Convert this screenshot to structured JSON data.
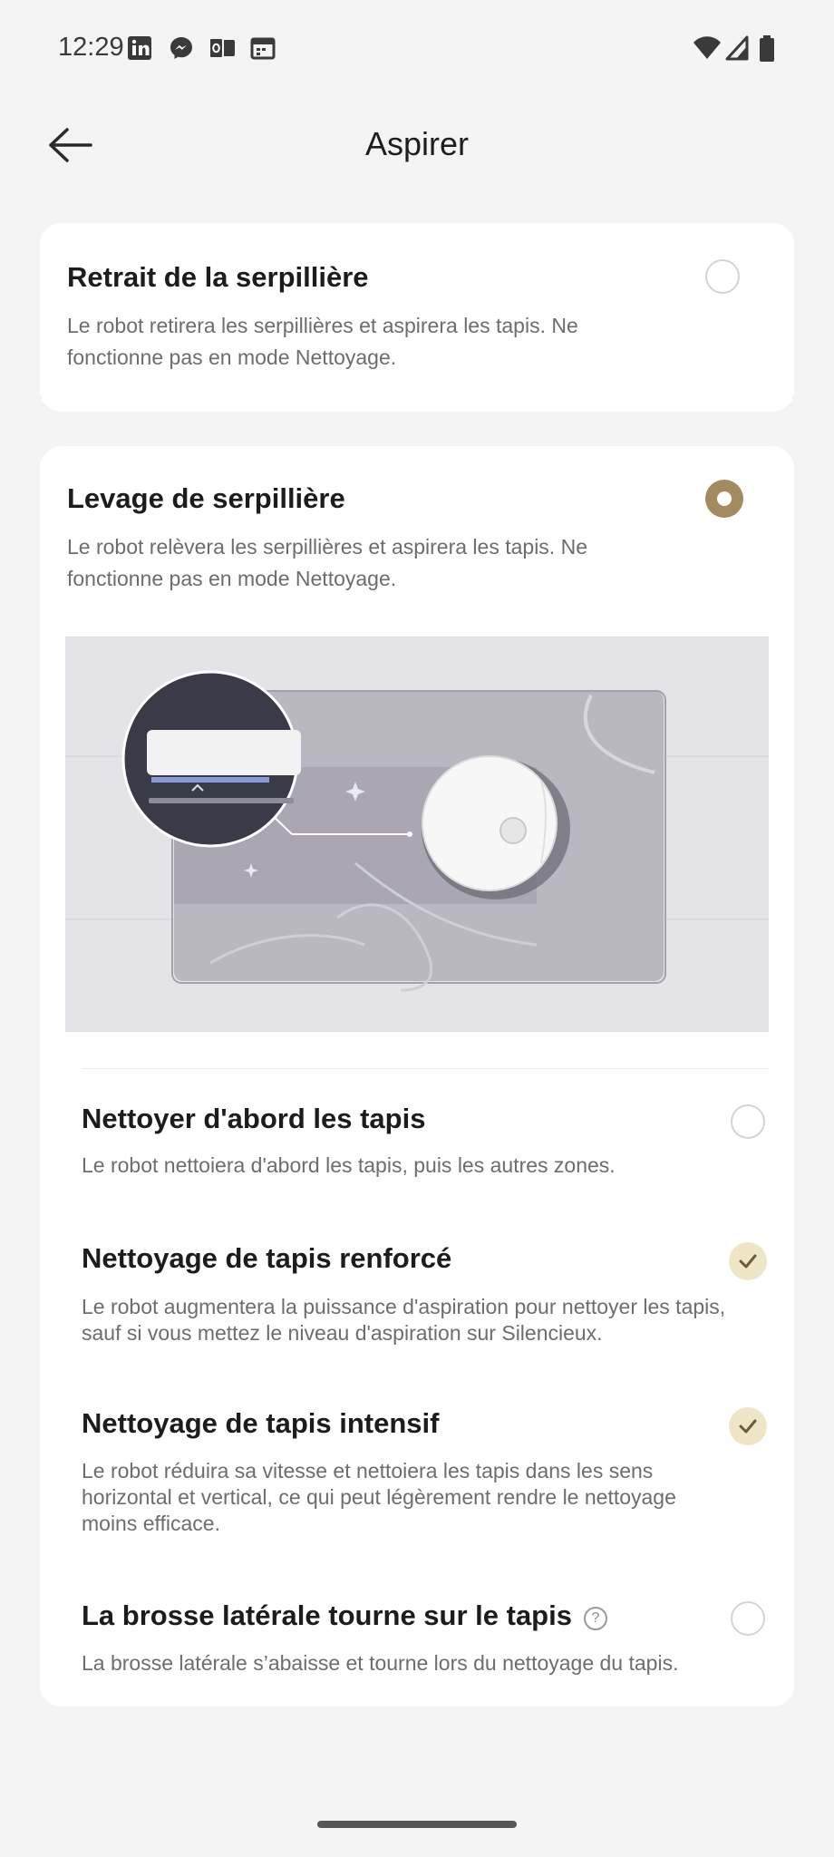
{
  "status_bar": {
    "time": "12:29",
    "notification_icons": [
      "linkedin-icon",
      "messenger-icon",
      "outlook-icon",
      "calendar-icon"
    ],
    "system_icons": [
      "wifi-icon",
      "signal-icon",
      "battery-icon"
    ]
  },
  "header": {
    "title": "Aspirer",
    "back_icon": "arrow-left-icon"
  },
  "options": [
    {
      "title": "Retrait de la serpillière",
      "description": "Le robot retirera les serpillières et aspirera les tapis. Ne fonctionne pas en mode Nettoyage.",
      "selected": false
    },
    {
      "title": "Levage de serpillière",
      "description": "Le robot relèvera les serpillières et aspirera les tapis. Ne fonctionne pas en mode Nettoyage.",
      "selected": true
    }
  ],
  "sub_options": [
    {
      "title": "Nettoyer d'abord les tapis",
      "description": "Le robot nettoiera d'abord les tapis, puis les autres zones.",
      "checked": false
    },
    {
      "title": "Nettoyage de tapis renforcé",
      "description": "Le robot augmentera la puissance d'aspiration pour nettoyer les tapis, sauf si vous mettez le niveau d'aspiration sur Silencieux.",
      "checked": true
    },
    {
      "title": "Nettoyage de tapis intensif",
      "description": "Le robot réduira sa vitesse et nettoiera les tapis dans les sens horizontal et vertical, ce qui peut légèrement rendre le nettoyage moins efficace.",
      "checked": true
    },
    {
      "title": "La brosse latérale tourne sur le tapis",
      "description": "La brosse latérale s’abaisse et tourne lors du nettoyage du tapis.",
      "checked": false,
      "help_icon": "question-circle-icon"
    }
  ],
  "colors": {
    "accent": "#a48a5f",
    "check_bg": "#efe6c8",
    "background": "#f4f4f4",
    "card": "#ffffff"
  }
}
